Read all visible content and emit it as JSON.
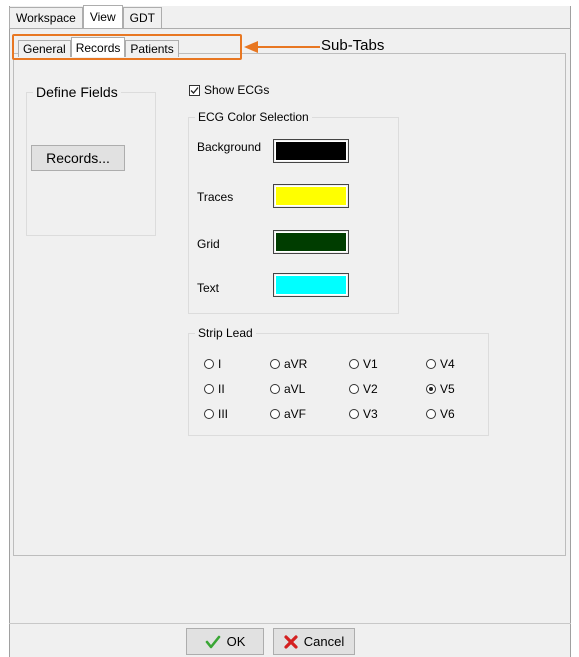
{
  "top_tabs": [
    {
      "label": "Workspace",
      "active": false
    },
    {
      "label": "View",
      "active": true
    },
    {
      "label": "GDT",
      "active": false
    }
  ],
  "sub_tabs": [
    {
      "label": "General",
      "active": false
    },
    {
      "label": "Records",
      "active": true
    },
    {
      "label": "Patients",
      "active": false
    }
  ],
  "annotation": {
    "label": "Sub-Tabs",
    "color": "#e87722"
  },
  "define_fields": {
    "legend": "Define Fields",
    "records_button": "Records..."
  },
  "show_ecgs": {
    "label": "Show ECGs",
    "checked": true
  },
  "ecg_color_selection": {
    "legend": "ECG Color Selection",
    "rows": [
      {
        "label": "Background",
        "color": "#000000"
      },
      {
        "label": "Traces",
        "color": "#ffff00"
      },
      {
        "label": "Grid",
        "color": "#003d00"
      },
      {
        "label": "Text",
        "color": "#00ffff"
      }
    ]
  },
  "strip_lead": {
    "legend": "Strip Lead",
    "options": [
      "I",
      "aVR",
      "V1",
      "V4",
      "II",
      "aVL",
      "V2",
      "V5",
      "III",
      "aVF",
      "V3",
      "V6"
    ],
    "selected": "V5"
  },
  "footer": {
    "ok_label": "OK",
    "cancel_label": "Cancel"
  }
}
